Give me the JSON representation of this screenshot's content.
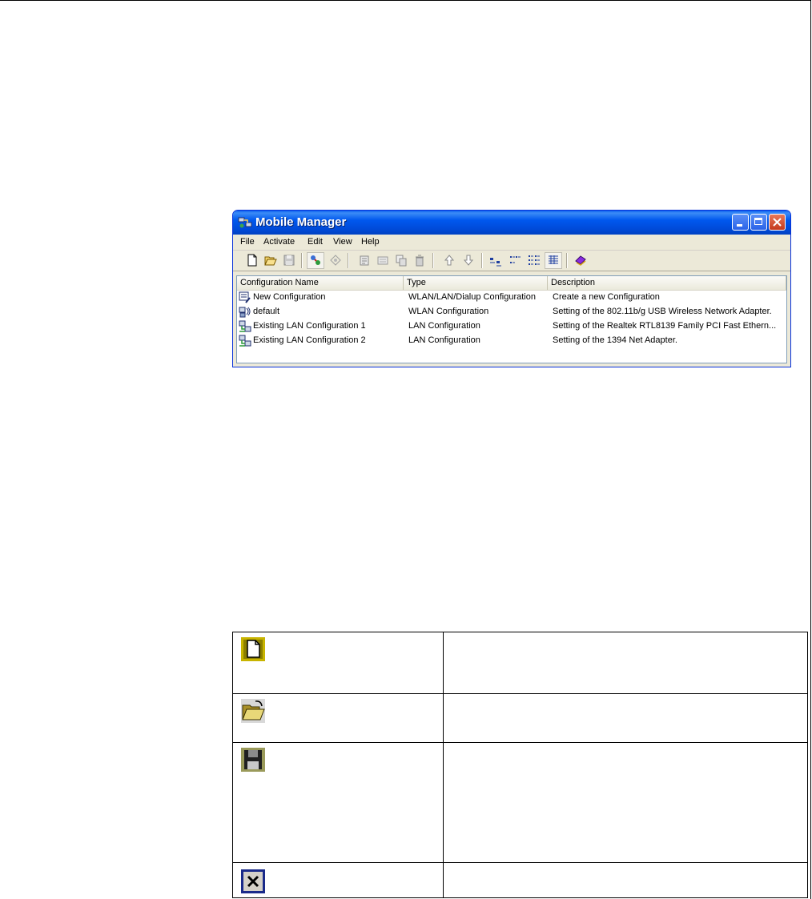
{
  "window": {
    "title": "Mobile Manager"
  },
  "menu": [
    "File",
    "Activate",
    "Edit",
    "View",
    "Help"
  ],
  "toolbar_icons": [
    "new-file-icon",
    "open-folder-icon",
    "save-icon",
    "activate-icon",
    "deactivate-icon",
    "properties-icon",
    "rename-icon",
    "copy-icon",
    "delete-icon",
    "move-up-icon",
    "move-down-icon",
    "large-icons-view-icon",
    "small-icons-view-icon",
    "list-view-icon",
    "details-view-icon",
    "help-book-icon"
  ],
  "list": {
    "columns": [
      "Configuration Name",
      "Type",
      "Description"
    ],
    "rows": [
      {
        "icon": "new-configuration-icon",
        "name": "New Configuration",
        "type": "WLAN/LAN/Dialup Configuration",
        "description": "Create a new Configuration"
      },
      {
        "icon": "wlan-configuration-icon",
        "name": "default",
        "type": "WLAN Configuration",
        "description": "Setting of the 802.11b/g USB Wireless Network Adapter."
      },
      {
        "icon": "lan-configuration-icon",
        "name": "Existing LAN Configuration 1",
        "type": "LAN Configuration",
        "description": "Setting of the Realtek RTL8139 Family PCI Fast Ethern..."
      },
      {
        "icon": "lan-configuration-icon",
        "name": "Existing LAN Configuration 2",
        "type": "LAN Configuration",
        "description": "Setting of the 1394 Net Adapter."
      }
    ]
  },
  "icon_table": [
    {
      "icon": "new-file-icon",
      "description": ""
    },
    {
      "icon": "open-folder-icon",
      "description": ""
    },
    {
      "icon": "save-icon",
      "description": ""
    },
    {
      "icon": "close-icon",
      "description": ""
    }
  ],
  "colors": {
    "titlebar": "#0058ee",
    "window_face": "#ece9d8",
    "list_border": "#7f9db9"
  }
}
